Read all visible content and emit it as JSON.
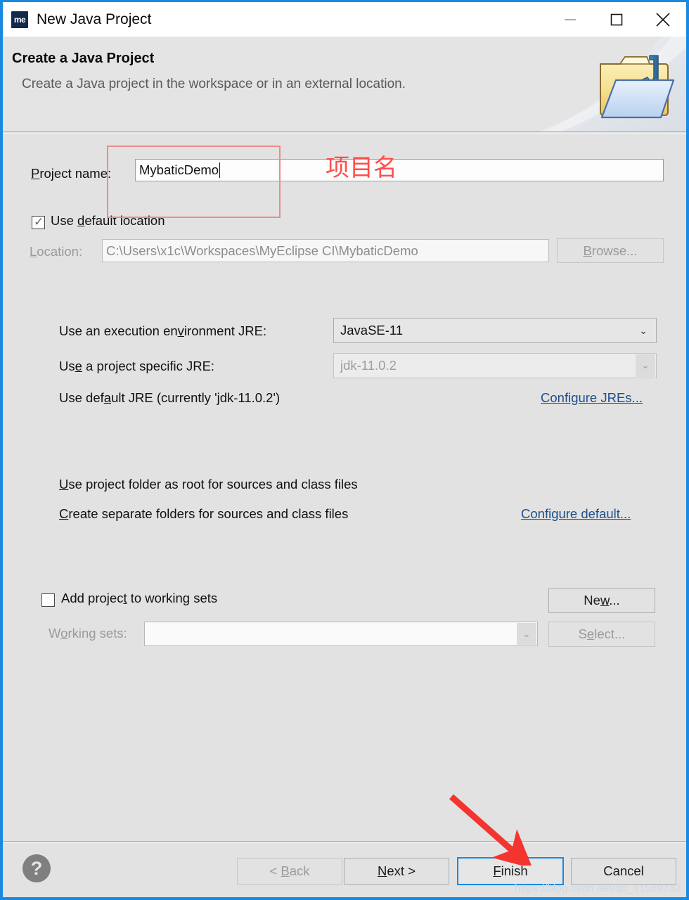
{
  "window": {
    "title": "New Java Project",
    "app_icon_text": "me",
    "minimize_label": "Minimize",
    "maximize_label": "Maximize",
    "close_label": "Close"
  },
  "header": {
    "title": "Create a Java Project",
    "subtitle": "Create a Java project in the workspace or in an external location."
  },
  "form": {
    "project_name_label": "Project name:",
    "project_name_value": "MybaticDemo",
    "use_default_location_label": "Use default location",
    "use_default_location_checked": true,
    "location_label": "Location:",
    "location_value": "C:\\Users\\x1c\\Workspaces\\MyEclipse CI\\MybaticDemo",
    "browse_label": "Browse...",
    "jre": {
      "execution_env_label": "Use an execution environment JRE:",
      "execution_env_value": "JavaSE-11",
      "project_specific_label": "Use a project specific JRE:",
      "project_specific_value": "jdk-11.0.2",
      "default_jre_label": "Use default JRE (currently 'jdk-11.0.2')",
      "configure_jres_link": "Configure JREs..."
    },
    "layout": {
      "use_project_folder_label": "Use project folder as root for sources and class files",
      "create_separate_folders_label": "Create separate folders for sources and class files",
      "configure_default_link": "Configure default..."
    },
    "working_sets": {
      "add_project_label": "Add project to working sets",
      "add_project_checked": false,
      "new_button_label": "New...",
      "working_sets_label": "Working sets:",
      "working_sets_value": "",
      "select_button_label": "Select..."
    }
  },
  "footer": {
    "help_glyph": "?",
    "back_label": "< Back",
    "next_label": "Next >",
    "finish_label": "Finish",
    "cancel_label": "Cancel"
  },
  "annotations": {
    "project_name_note": "项目名",
    "watermark": "https://blog.csdn.net/qq_41569732"
  },
  "colors": {
    "accent": "#1a8ae0",
    "annotation_red": "#ff4d4d",
    "annotation_box": "#ef8a8a",
    "arrow_red": "#f4352f",
    "dialog_bg": "#e2e2e2",
    "link": "#1b4f8c"
  }
}
